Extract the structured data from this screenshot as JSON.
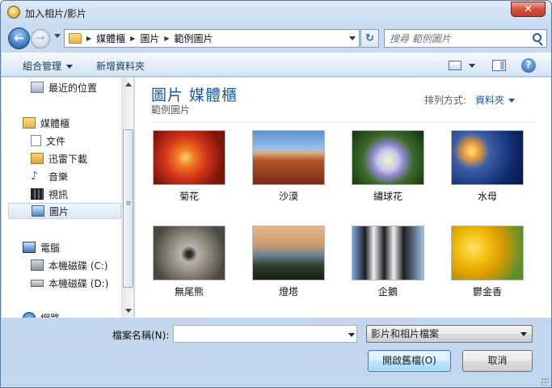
{
  "window": {
    "title": "加入相片/影片",
    "close_glyph": "✕"
  },
  "nav": {
    "back_glyph": "←",
    "forward_glyph": "→",
    "breadcrumb": [
      "媒體櫃",
      "圖片",
      "範例圖片"
    ],
    "refresh_glyph": "↻",
    "search_placeholder": "搜尋 範例圖片"
  },
  "toolbar": {
    "organize": "組合管理",
    "new_folder": "新增資料夾",
    "help_glyph": "?"
  },
  "sidebar": {
    "items": [
      {
        "label": "最近的位置",
        "icon": "recent-places-icon"
      },
      {
        "label": "媒體櫃",
        "icon": "libraries-icon"
      },
      {
        "label": "文件",
        "icon": "documents-icon"
      },
      {
        "label": "迅雷下載",
        "icon": "download-folder-icon"
      },
      {
        "label": "音樂",
        "icon": "music-icon"
      },
      {
        "label": "視訊",
        "icon": "videos-icon"
      },
      {
        "label": "圖片",
        "icon": "pictures-icon",
        "selected": true
      },
      {
        "label": "電腦",
        "icon": "computer-icon"
      },
      {
        "label": "本機磁碟 (C:)",
        "icon": "system-drive-icon"
      },
      {
        "label": "本機磁碟 (D:)",
        "icon": "drive-icon"
      },
      {
        "label": "網路",
        "icon": "network-icon"
      }
    ]
  },
  "content": {
    "library_title": "圖片 媒體櫃",
    "library_subtitle": "範例圖片",
    "sort_label": "排列方式:",
    "sort_value": "資料夾",
    "thumbnails": [
      {
        "caption": "菊花",
        "icon": "chrysanthemum-photo"
      },
      {
        "caption": "沙漠",
        "icon": "desert-photo"
      },
      {
        "caption": "繡球花",
        "icon": "hydrangeas-photo"
      },
      {
        "caption": "水母",
        "icon": "jellyfish-photo"
      },
      {
        "caption": "無尾熊",
        "icon": "koala-photo"
      },
      {
        "caption": "燈塔",
        "icon": "lighthouse-photo"
      },
      {
        "caption": "企鵝",
        "icon": "penguins-photo"
      },
      {
        "caption": "鬱金香",
        "icon": "tulips-photo"
      }
    ]
  },
  "bottom": {
    "filename_label": "檔案名稱(N):",
    "filename_value": "",
    "filter_value": "影片和相片檔案",
    "open_button": "開啟舊檔(O)",
    "cancel_button": "取消"
  },
  "colors": {
    "accent": "#1e5a9d",
    "title_bar": "#c9dbf0"
  }
}
